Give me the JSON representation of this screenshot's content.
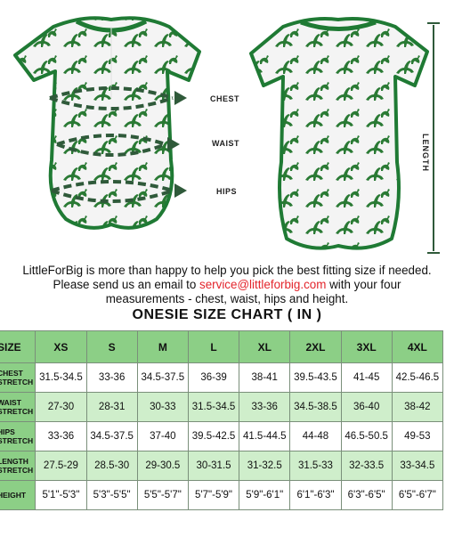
{
  "illustration": {
    "measure_labels": {
      "chest": "CHEST",
      "waist": "WAIST",
      "hips": "HIPS",
      "length": "LENGTH"
    },
    "colors": {
      "trim": "#1f7a34",
      "fabric": "#f3f3f3",
      "print": "#2a7a34",
      "arrow": "#2f5a3a"
    }
  },
  "intro": {
    "line1": "LittleForBig is more than happy to help you pick the best fitting size if needed.",
    "line2_pre": "Please send us an email to ",
    "email": "service@littleforbig.com",
    "line2_post": " with your four",
    "line3": "measurements - chest, waist, hips and height."
  },
  "chart_title": "ONESIE SIZE CHART ( IN )",
  "table": {
    "header_label": "SIZE",
    "sizes": [
      "XS",
      "S",
      "M",
      "L",
      "XL",
      "2XL",
      "3XL",
      "4XL"
    ],
    "rows": [
      {
        "label": "CHEST STRETCH",
        "values": [
          "31.5-34.5",
          "33-36",
          "34.5-37.5",
          "36-39",
          "38-41",
          "39.5-43.5",
          "41-45",
          "42.5-46.5"
        ]
      },
      {
        "label": "WAIST STRETCH",
        "values": [
          "27-30",
          "28-31",
          "30-33",
          "31.5-34.5",
          "33-36",
          "34.5-38.5",
          "36-40",
          "38-42"
        ]
      },
      {
        "label": "HIPS STRETCH",
        "values": [
          "33-36",
          "34.5-37.5",
          "37-40",
          "39.5-42.5",
          "41.5-44.5",
          "44-48",
          "46.5-50.5",
          "49-53"
        ]
      },
      {
        "label": "LENGTH STRETCH",
        "values": [
          "27.5-29",
          "28.5-30",
          "29-30.5",
          "30-31.5",
          "31-32.5",
          "31.5-33",
          "32-33.5",
          "33-34.5"
        ]
      },
      {
        "label": "HEIGHT",
        "values": [
          "5'1\"-5'3\"",
          "5'3\"-5'5\"",
          "5'5\"-5'7\"",
          "5'7\"-5'9\"",
          "5'9\"-6'1\"",
          "6'1\"-6'3\"",
          "6'3\"-6'5\"",
          "6'5\"-6'7\""
        ]
      }
    ]
  }
}
